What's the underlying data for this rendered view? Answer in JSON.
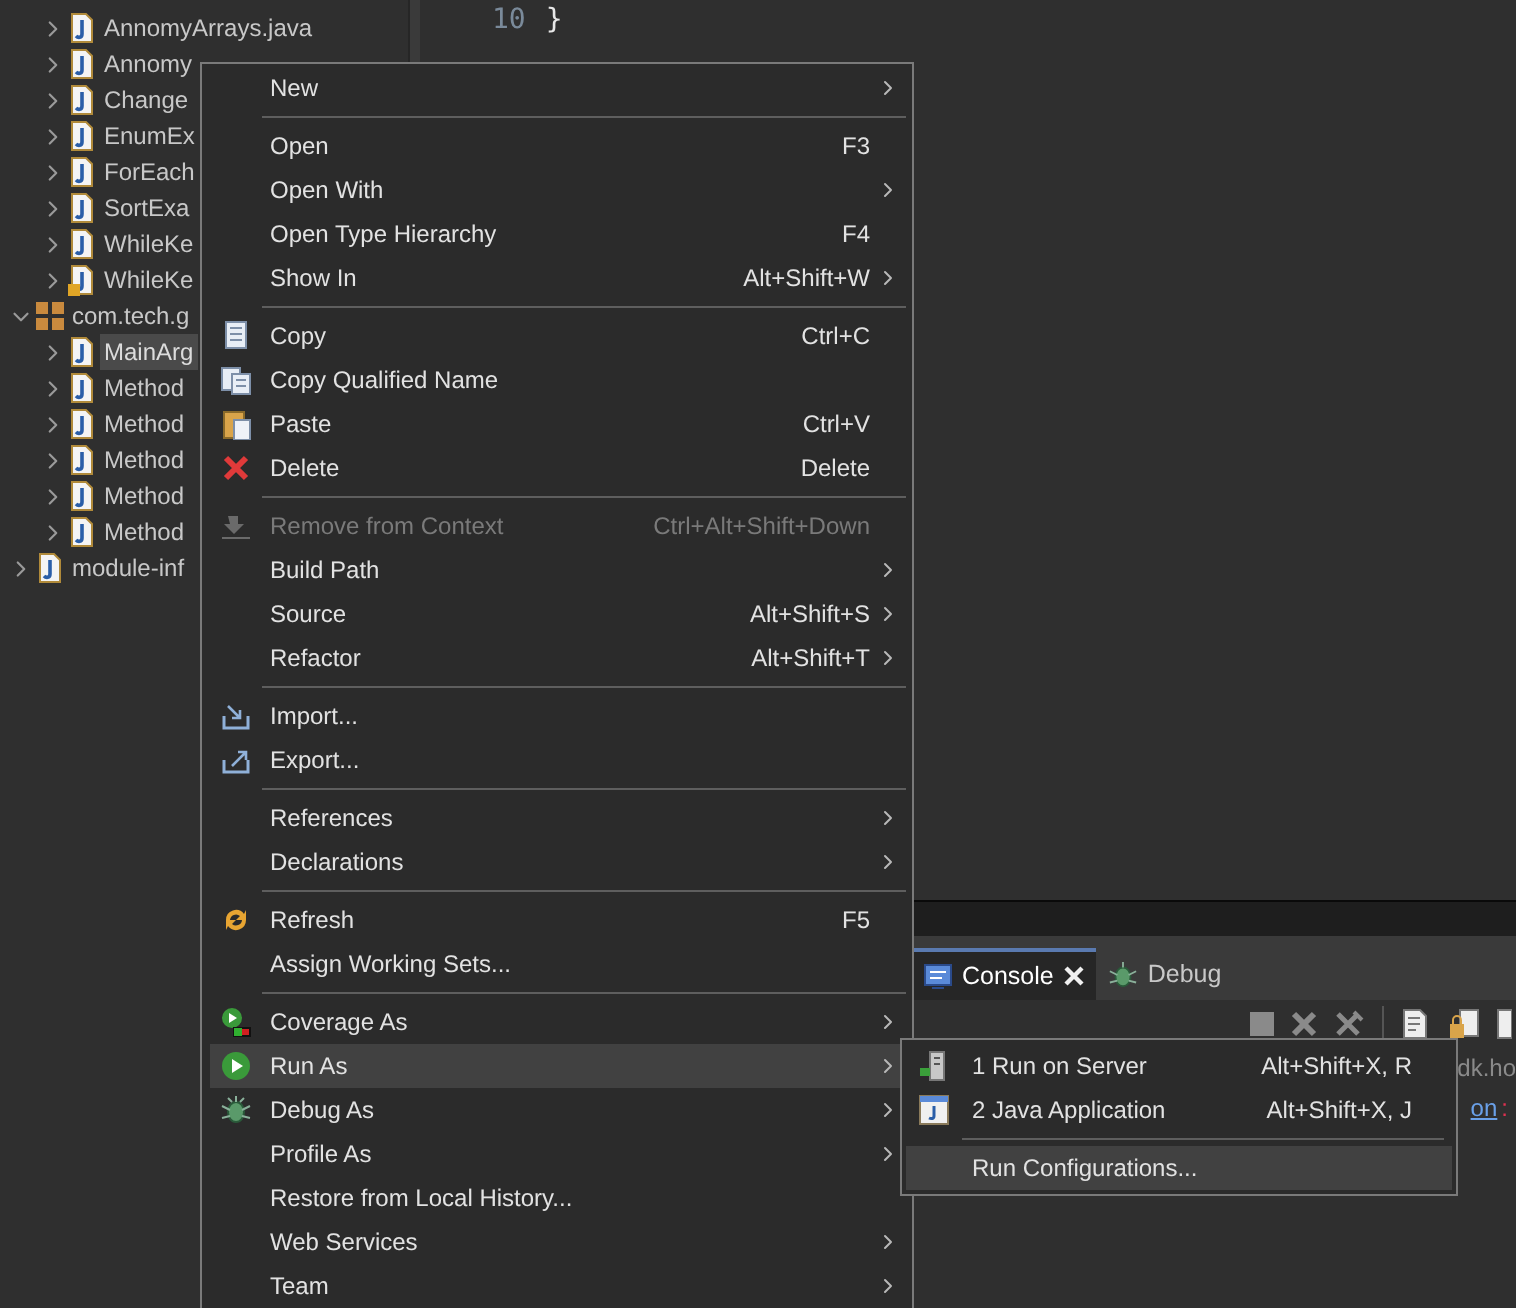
{
  "tree": {
    "children_of_previous_package": [
      {
        "label": "AnnomyArrays.java",
        "selected": false,
        "warning": false
      },
      {
        "label": "Annomy",
        "selected": false,
        "warning": false
      },
      {
        "label": "Change",
        "selected": false,
        "warning": false
      },
      {
        "label": "EnumEx",
        "selected": false,
        "warning": false
      },
      {
        "label": "ForEach",
        "selected": false,
        "warning": false
      },
      {
        "label": "SortExa",
        "selected": false,
        "warning": false
      },
      {
        "label": "WhileKe",
        "selected": false,
        "warning": false
      },
      {
        "label": "WhileKe",
        "selected": false,
        "warning": true
      }
    ],
    "items": [
      {
        "label": "com.tech.g",
        "kind": "package",
        "expanded": true,
        "children": [
          {
            "label": "MainArg",
            "selected": true,
            "warning": false
          },
          {
            "label": "Method",
            "selected": false,
            "warning": false
          },
          {
            "label": "Method",
            "selected": false,
            "warning": false
          },
          {
            "label": "Method",
            "selected": false,
            "warning": false
          },
          {
            "label": "Method",
            "selected": false,
            "warning": false
          },
          {
            "label": "Method",
            "selected": false,
            "warning": false
          }
        ]
      },
      {
        "label": "module-inf",
        "kind": "file",
        "expanded": false
      }
    ]
  },
  "editor": {
    "lines": [
      {
        "number": "10",
        "code": "}"
      }
    ]
  },
  "bottom_panel": {
    "tabs": [
      {
        "label": "Console",
        "selected": true,
        "closable": true
      },
      {
        "label": "Debug",
        "selected": false,
        "closable": false
      }
    ],
    "console_lines": [
      {
        "text": "dk.ho"
      },
      {
        "link": "on",
        "suffix": ":"
      }
    ]
  },
  "context_menu": {
    "items": [
      {
        "kind": "item",
        "label": "New",
        "submenu": true,
        "disabled": false,
        "selected": false
      },
      {
        "kind": "separator"
      },
      {
        "kind": "item",
        "label": "Open",
        "shortcut": "F3",
        "submenu": false,
        "disabled": false,
        "selected": false
      },
      {
        "kind": "item",
        "label": "Open With",
        "submenu": true,
        "disabled": false,
        "selected": false
      },
      {
        "kind": "item",
        "label": "Open Type Hierarchy",
        "shortcut": "F4",
        "submenu": false,
        "disabled": false,
        "selected": false
      },
      {
        "kind": "item",
        "label": "Show In",
        "shortcut": "Alt+Shift+W",
        "submenu": true,
        "disabled": false,
        "selected": false
      },
      {
        "kind": "separator"
      },
      {
        "kind": "item",
        "label": "Copy",
        "shortcut": "Ctrl+C",
        "submenu": false,
        "disabled": false,
        "selected": false
      },
      {
        "kind": "item",
        "label": "Copy Qualified Name",
        "submenu": false,
        "disabled": false,
        "selected": false
      },
      {
        "kind": "item",
        "label": "Paste",
        "shortcut": "Ctrl+V",
        "submenu": false,
        "disabled": false,
        "selected": false
      },
      {
        "kind": "item",
        "label": "Delete",
        "shortcut": "Delete",
        "submenu": false,
        "disabled": false,
        "selected": false
      },
      {
        "kind": "separator"
      },
      {
        "kind": "item",
        "label": "Remove from Context",
        "shortcut": "Ctrl+Alt+Shift+Down",
        "submenu": false,
        "disabled": true,
        "selected": false
      },
      {
        "kind": "item",
        "label": "Build Path",
        "submenu": true,
        "disabled": false,
        "selected": false
      },
      {
        "kind": "item",
        "label": "Source",
        "shortcut": "Alt+Shift+S",
        "submenu": true,
        "disabled": false,
        "selected": false
      },
      {
        "kind": "item",
        "label": "Refactor",
        "shortcut": "Alt+Shift+T",
        "submenu": true,
        "disabled": false,
        "selected": false
      },
      {
        "kind": "separator"
      },
      {
        "kind": "item",
        "label": "Import...",
        "submenu": false,
        "disabled": false,
        "selected": false
      },
      {
        "kind": "item",
        "label": "Export...",
        "submenu": false,
        "disabled": false,
        "selected": false
      },
      {
        "kind": "separator"
      },
      {
        "kind": "item",
        "label": "References",
        "submenu": true,
        "disabled": false,
        "selected": false
      },
      {
        "kind": "item",
        "label": "Declarations",
        "submenu": true,
        "disabled": false,
        "selected": false
      },
      {
        "kind": "separator"
      },
      {
        "kind": "item",
        "label": "Refresh",
        "shortcut": "F5",
        "submenu": false,
        "disabled": false,
        "selected": false
      },
      {
        "kind": "item",
        "label": "Assign Working Sets...",
        "submenu": false,
        "disabled": false,
        "selected": false
      },
      {
        "kind": "separator"
      },
      {
        "kind": "item",
        "label": "Coverage As",
        "submenu": true,
        "disabled": false,
        "selected": false
      },
      {
        "kind": "item",
        "label": "Run As",
        "submenu": true,
        "disabled": false,
        "selected": true
      },
      {
        "kind": "item",
        "label": "Debug As",
        "submenu": true,
        "disabled": false,
        "selected": false
      },
      {
        "kind": "item",
        "label": "Profile As",
        "submenu": true,
        "disabled": false,
        "selected": false
      },
      {
        "kind": "item",
        "label": "Restore from Local History...",
        "submenu": false,
        "disabled": false,
        "selected": false
      },
      {
        "kind": "item",
        "label": "Web Services",
        "submenu": true,
        "disabled": false,
        "selected": false
      },
      {
        "kind": "item",
        "label": "Team",
        "submenu": true,
        "disabled": false,
        "selected": false
      }
    ]
  },
  "run_as_submenu": {
    "items": [
      {
        "kind": "item",
        "label": "1 Run on Server",
        "shortcut": "Alt+Shift+X, R",
        "selected": false
      },
      {
        "kind": "item",
        "label": "2 Java Application",
        "shortcut": "Alt+Shift+X, J",
        "selected": false
      },
      {
        "kind": "separator"
      },
      {
        "kind": "item",
        "label": "Run Configurations...",
        "selected": true
      }
    ]
  }
}
